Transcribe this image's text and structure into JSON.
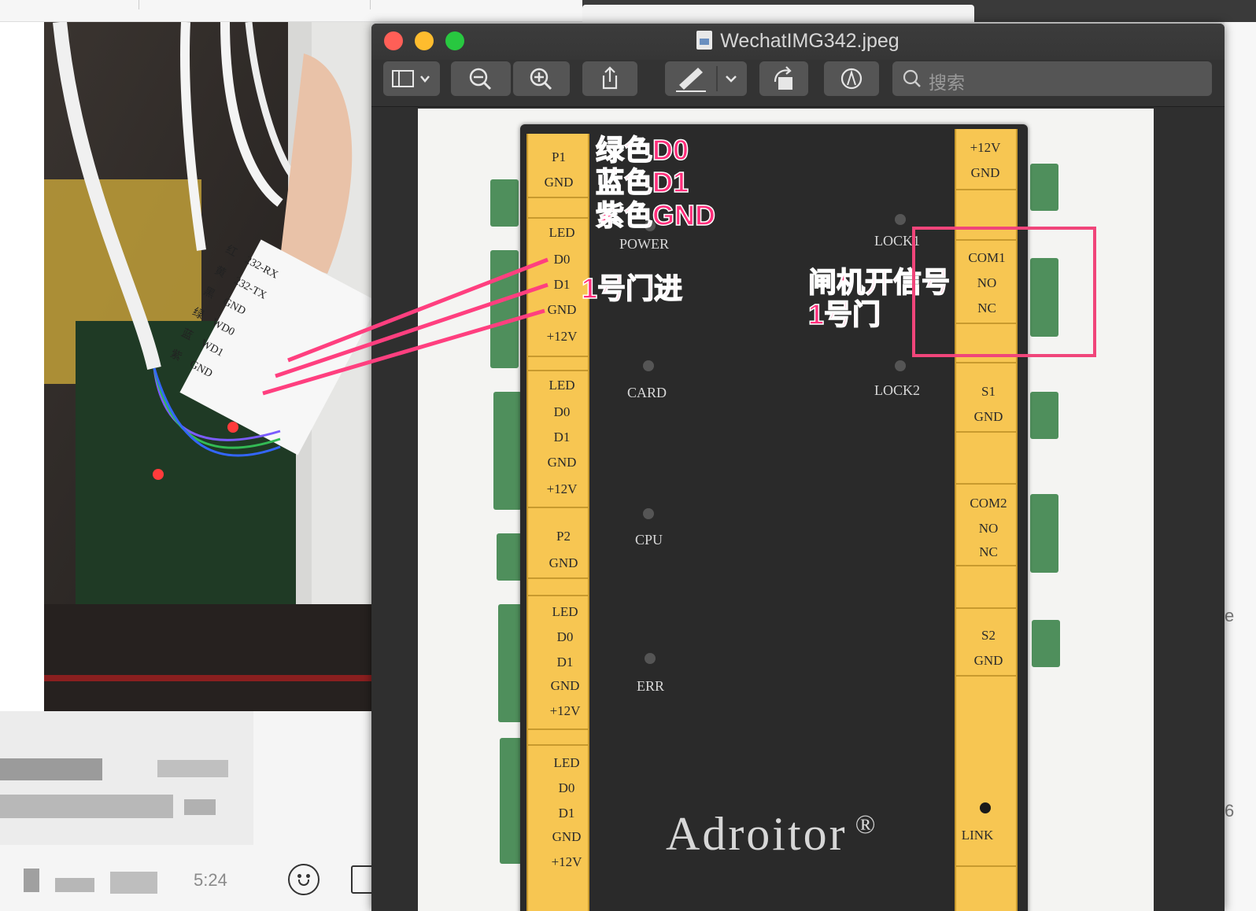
{
  "preview_window": {
    "title": "WechatIMG342.jpeg",
    "traffic_lights": {
      "close": "#ff5f57",
      "minimize": "#febc2e",
      "zoom": "#28c840"
    },
    "toolbar": {
      "sidebar_icon": "sidebar-icon",
      "zoom_out_icon": "zoom-out-icon",
      "zoom_in_icon": "zoom-in-icon",
      "share_icon": "share-icon",
      "markup_pen_icon": "pen-icon",
      "rotate_icon": "rotate-icon",
      "annotate_icon": "markup-icon",
      "search_placeholder": "搜索"
    }
  },
  "image": {
    "brand": "Adroitor",
    "registered": "®",
    "left_strip": [
      [
        "P1",
        "GND"
      ],
      [
        "LED",
        "D0",
        "D1",
        "GND",
        "+12V"
      ],
      [
        "LED",
        "D0",
        "D1",
        "GND",
        "+12V"
      ],
      [
        "P2",
        "GND"
      ],
      [
        "LED",
        "D0",
        "D1",
        "GND",
        "+12V"
      ],
      [
        "LED",
        "D0",
        "D1",
        "GND",
        "+12V"
      ]
    ],
    "right_strip": [
      [
        "+12V",
        "GND"
      ],
      [
        "COM1",
        "NO",
        "NC"
      ],
      [
        "S1",
        "GND"
      ],
      [
        "COM2",
        "NO",
        "NC"
      ],
      [
        "S2",
        "GND"
      ],
      [
        "LINK"
      ]
    ],
    "indicators": [
      "POWER",
      "LOCK1",
      "CARD",
      "LOCK2",
      "CPU",
      "ERR"
    ],
    "annotations": {
      "wires": [
        "绿色D0",
        "蓝色D1",
        "紫色GND"
      ],
      "door_in": "1号门进",
      "gate_signal": [
        "闸机开信号",
        "1号门"
      ]
    },
    "annotation_color": "#ff2d7a"
  },
  "chat": {
    "time": "5:24",
    "emoji_icon": "emoji-icon",
    "folder_icon": "folder-icon"
  },
  "label_card": {
    "rows": [
      [
        "红",
        "232-RX"
      ],
      [
        "黄",
        "232-TX"
      ],
      [
        "黑",
        "GND"
      ],
      [
        "绿",
        "WD0"
      ],
      [
        "蓝",
        "WD1"
      ],
      [
        "紫",
        "GND"
      ]
    ]
  },
  "right_edge": {
    "text_e": "e",
    "text_6": "6"
  }
}
